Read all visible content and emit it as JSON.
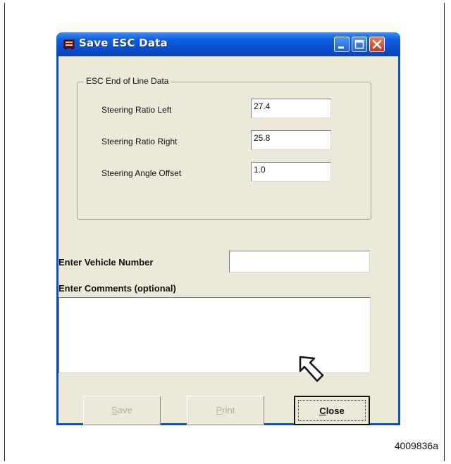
{
  "window": {
    "title": "Save ESC Data",
    "icon": "app-icon",
    "controls": [
      "minimize-icon",
      "maximize-icon",
      "close-icon"
    ]
  },
  "group": {
    "legend": "ESC End of Line Data",
    "rows": [
      {
        "label": "Steering Ratio Left",
        "value": "27.4"
      },
      {
        "label": "Steering Ratio Right",
        "value": "25.8"
      },
      {
        "label": "Steering Angle Offset",
        "value": "1.0"
      }
    ]
  },
  "vehicle": {
    "label": "Enter Vehicle Number",
    "value": ""
  },
  "comments": {
    "label": "Enter Comments (optional)",
    "value": ""
  },
  "buttons": {
    "save": {
      "mnemonic": "S",
      "rest": "ave",
      "enabled": false
    },
    "print": {
      "mnemonic": "P",
      "rest": "rint",
      "enabled": false
    },
    "close": {
      "mnemonic": "C",
      "rest": "lose",
      "enabled": true
    }
  },
  "figure_id": "4009836a"
}
